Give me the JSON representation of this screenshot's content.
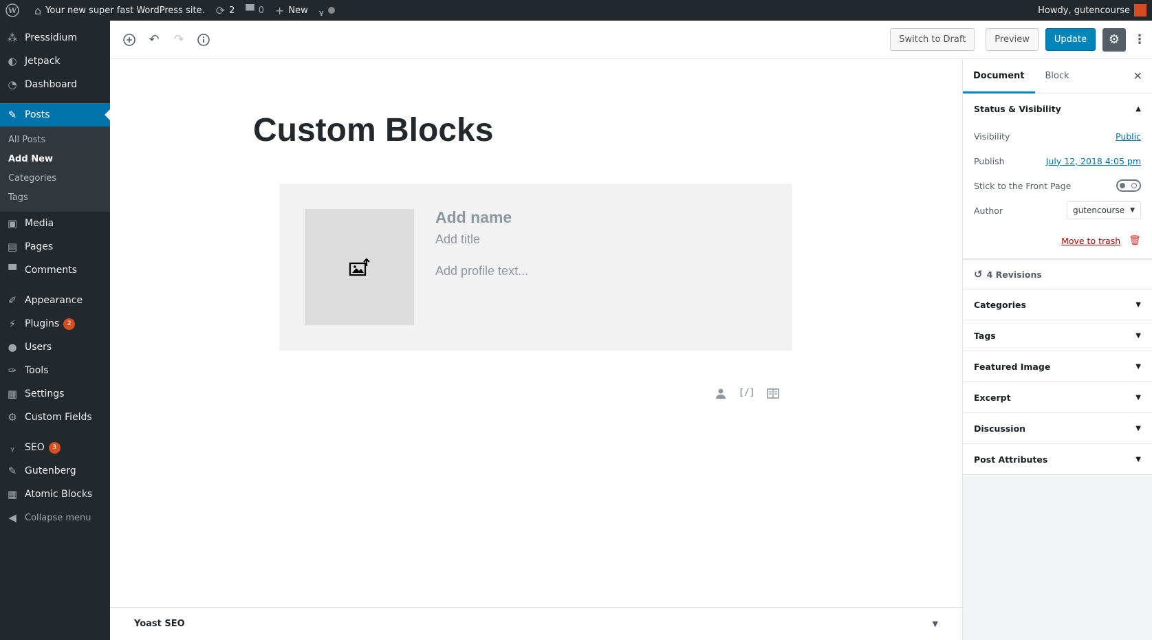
{
  "adminbar": {
    "site_name": "Your new super fast WordPress site.",
    "updates_count": "2",
    "comments_count": "0",
    "new_label": "New",
    "greeting": "Howdy, gutencourse"
  },
  "sidebar": {
    "items_top": [
      {
        "label": "Pressidium",
        "icon": "pressidium-icon"
      },
      {
        "label": "Jetpack",
        "icon": "jetpack-icon"
      },
      {
        "label": "Dashboard",
        "icon": "dashboard-icon"
      }
    ],
    "posts_label": "Posts",
    "posts_submenu": [
      "All Posts",
      "Add New",
      "Categories",
      "Tags"
    ],
    "items_mid": [
      {
        "label": "Media"
      },
      {
        "label": "Pages"
      },
      {
        "label": "Comments"
      }
    ],
    "appearance": "Appearance",
    "plugins": "Plugins",
    "plugins_badge": "2",
    "users": "Users",
    "tools": "Tools",
    "settings": "Settings",
    "custom_fields": "Custom Fields",
    "seo": "SEO",
    "seo_badge": "3",
    "gutenberg": "Gutenberg",
    "atomic_blocks": "Atomic Blocks",
    "collapse": "Collapse menu"
  },
  "header": {
    "switch_to_draft": "Switch to Draft",
    "preview": "Preview",
    "update": "Update"
  },
  "editor": {
    "post_title": "Custom Blocks",
    "name_placeholder": "Add name",
    "title_placeholder": "Add title",
    "profile_placeholder": "Add profile text...",
    "shortcode_glyph": "[/]",
    "yoast_label": "Yoast SEO"
  },
  "settings_sidebar": {
    "tab_document": "Document",
    "tab_block": "Block",
    "status_visibility": "Status & Visibility",
    "visibility_label": "Visibility",
    "visibility_value": "Public",
    "publish_label": "Publish",
    "publish_value": "July 12, 2018 4:05 pm",
    "stick_label": "Stick to the Front Page",
    "author_label": "Author",
    "author_value": "gutencourse",
    "move_to_trash": "Move to trash",
    "revisions": "4 Revisions",
    "panels": [
      "Categories",
      "Tags",
      "Featured Image",
      "Excerpt",
      "Discussion",
      "Post Attributes"
    ]
  },
  "colors": {
    "admin_dark": "#23282d",
    "accent_blue": "#0073aa",
    "primary_button": "#0085ba",
    "badge": "#d54e21"
  }
}
